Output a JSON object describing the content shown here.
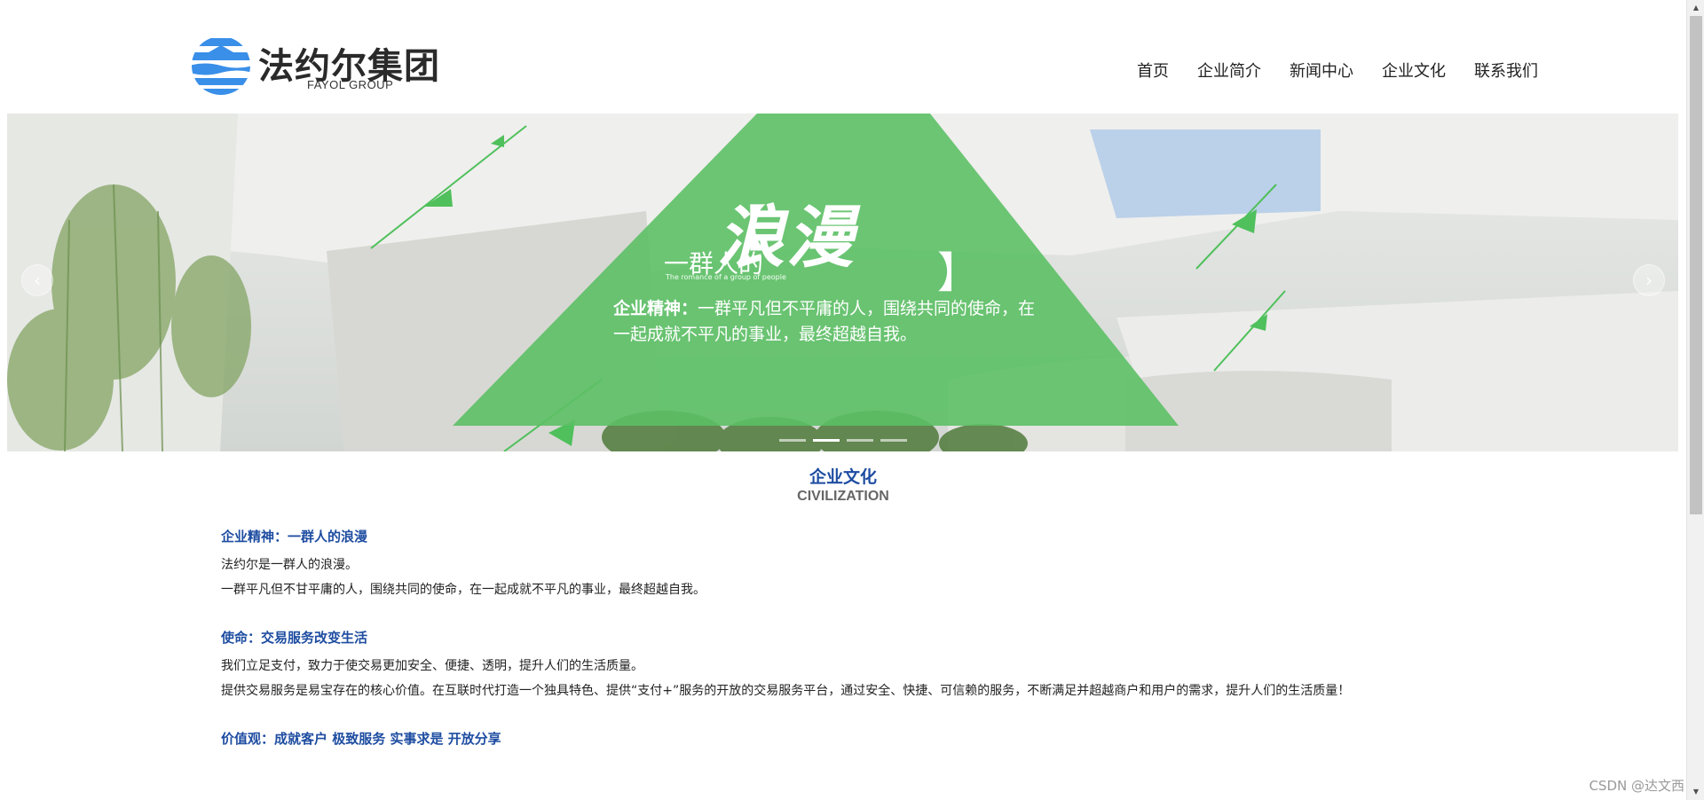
{
  "header": {
    "logo_cn": "法约尔集团",
    "logo_en": "FAYOL GROUP",
    "nav": [
      {
        "label": "首页"
      },
      {
        "label": "企业简介"
      },
      {
        "label": "新闻中心"
      },
      {
        "label": "企业文化"
      },
      {
        "label": "联系我们"
      }
    ]
  },
  "banner": {
    "slogan_small": "一群人的",
    "slogan_big": "浪漫",
    "slogan_en": "The romance of a group of people",
    "spirit_label": "企业精神：",
    "spirit_text": "一群平凡但不平庸的人，围绕共同的使命，在一起成就不平凡的事业，最终超越自我。",
    "prev_icon": "‹",
    "next_icon": "›",
    "slide_count": 4,
    "active_slide": 2,
    "accent_color": "#5cc065"
  },
  "section": {
    "title": "企业文化",
    "subtitle": "CIVILIZATION",
    "blocks": [
      {
        "heading": "企业精神：一群人的浪漫",
        "paragraphs": [
          "法约尔是一群人的浪漫。",
          "一群平凡但不甘平庸的人，围绕共同的使命，在一起成就不平凡的事业，最终超越自我。"
        ]
      },
      {
        "heading": "使命：交易服务改变生活",
        "paragraphs": [
          "我们立足支付，致力于使交易更加安全、便捷、透明，提升人们的生活质量。",
          "提供交易服务是易宝存在的核心价值。在互联时代打造一个独具特色、提供“支付+”服务的开放的交易服务平台，通过安全、快捷、可信赖的服务，不断满足并超越商户和用户的需求，提升人们的生活质量！"
        ]
      },
      {
        "heading": "价值观：成就客户 极致服务 实事求是 开放分享",
        "paragraphs": []
      }
    ]
  },
  "watermark": "CSDN @达文西",
  "colors": {
    "heading_blue": "#1e4da1",
    "logo_blue": "#3a8fe8"
  }
}
